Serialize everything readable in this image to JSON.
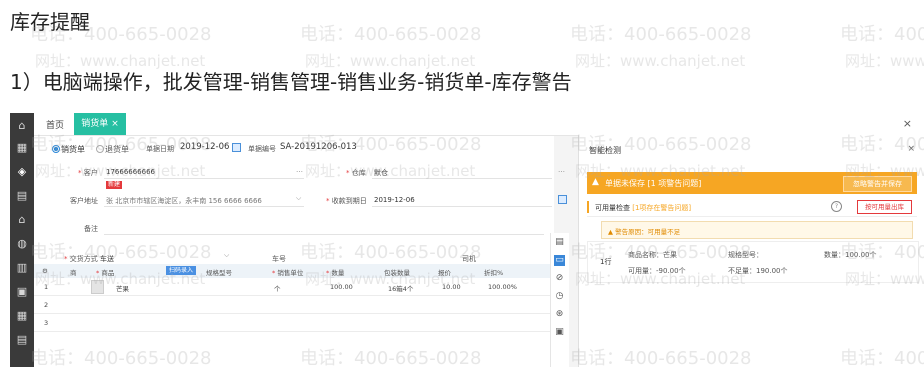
{
  "doc": {
    "heading": "库存提醒",
    "step": "1）电脑端操作，批发管理-销售管理-销售业务-销货单-库存警告"
  },
  "watermark": {
    "phone": "电话：400-665-0028",
    "url": "网址：www.chanjet.net"
  },
  "tabs": {
    "home": "首页",
    "active": "销货单",
    "close": "×",
    "window_close": "×"
  },
  "form": {
    "radio_sales": "销货单",
    "radio_return": "退货单",
    "date_label": "单据日期",
    "date_value": "2019-12-06",
    "no_label": "单据编号",
    "no_value": "SA-20191206-013",
    "customer_label": "客户",
    "customer_value": "17666666666",
    "customer_tag": "新建",
    "warehouse_label": "仓库",
    "warehouse_value": "默仓",
    "address_label": "客户地址",
    "address_value": "张 北京市市辖区海淀区，永丰南 156 6666 6666",
    "due_label": "收款到期日",
    "due_value": "2019-12-06",
    "remark_label": "备注",
    "delivery_label": "交货方式",
    "delivery_value": "车送",
    "car_label": "车号",
    "driver_label": "司机",
    "more": "..."
  },
  "grid": {
    "headers": [
      "商",
      "商品",
      "规格型号",
      "销售单位",
      "数量",
      "包装数量",
      "报价",
      "折扣%"
    ],
    "batch_button": "扫码录入",
    "rows": [
      {
        "no": "1",
        "product": "芒果",
        "unit": "个",
        "qty": "100.00",
        "pack": "16箱4个",
        "price": "10.00",
        "discount": "100.00%"
      },
      {
        "no": "2"
      },
      {
        "no": "3"
      }
    ]
  },
  "panel": {
    "title": "智能检测",
    "close": "×",
    "warning": "单据未保存 [1 项警告问题]",
    "ignore_button": "忽略警告并保存",
    "check_label": "可用量检查",
    "check_link": "[1项存在警告问题]",
    "goto_button": "按可用量出库",
    "reason": "警告原因：可用量不足",
    "row_no": "1行",
    "product_name": "商品名称：芒果",
    "spec": "规格型号：",
    "qty": "数量：100.00个",
    "available": "可用量：-90.00个",
    "shortage": "不足量：190.00个"
  },
  "icons": {
    "home": "⌂",
    "calendar": "▦",
    "info": "ⓘ"
  }
}
